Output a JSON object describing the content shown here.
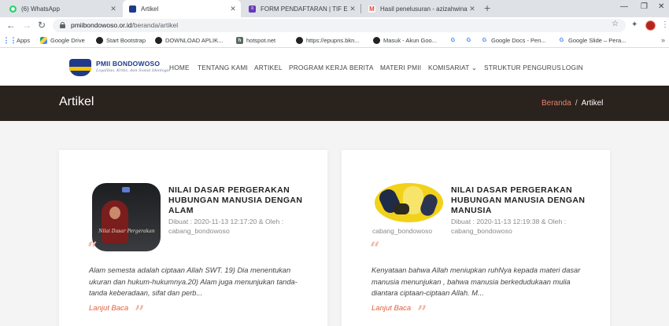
{
  "browser": {
    "tabs": [
      {
        "title": "(6) WhatsApp",
        "icon": "whatsapp-icon",
        "color": "#25d366",
        "glyph": "◉"
      },
      {
        "title": "Artikel",
        "icon": "pmii-logo-icon",
        "color": "#1f3a8a",
        "glyph": ""
      },
      {
        "title": "FORM PENDAFTARAN | TIF EXHIBITION",
        "icon": "google-forms-icon",
        "color": "#673ab7",
        "glyph": "≡"
      },
      {
        "title": "Hasil penelusuran - azizahwinarsih",
        "icon": "gmail-icon",
        "color": "#ea4335",
        "glyph": "M"
      }
    ],
    "new_tab": "+",
    "url_host": "pmiibondowoso.or.id",
    "url_path": "/beranda/artikel",
    "bookmarks": [
      {
        "label": "Apps",
        "icon": "apps-grid-icon"
      },
      {
        "label": "Google Drive",
        "icon": "google-drive-icon"
      },
      {
        "label": "Start Bootstrap",
        "icon": "bootstrap-icon"
      },
      {
        "label": "DOWNLOAD APLIK...",
        "icon": "globe-icon"
      },
      {
        "label": "hotspot.net",
        "icon": "hotspot-icon"
      },
      {
        "label": "https://epupns.bkn...",
        "icon": "globe-icon"
      },
      {
        "label": "Masuk - Akun Goo...",
        "icon": "globe-icon"
      },
      {
        "label": "",
        "icon": "google-icon"
      },
      {
        "label": "",
        "icon": "google-icon"
      },
      {
        "label": "Google Docs - Pen...",
        "icon": "google-icon"
      },
      {
        "label": "Google Slide – Pera...",
        "icon": "google-icon"
      }
    ]
  },
  "site": {
    "brand": "PMII BONDOWOSO",
    "tagline": "Loyalitas, Kritis, dan Sosial Ideologis",
    "menu": [
      "HOME",
      "TENTANG KAMI",
      "ARTIKEL",
      "PROGRAM KERJA",
      "BERITA",
      "MATERI PMII",
      "KOMISARIAT",
      "STRUKTUR PENGURUS",
      "LOGIN"
    ],
    "dropdown_caret": "⌄"
  },
  "banner": {
    "title": "Artikel",
    "breadcrumb_home": "Beranda",
    "breadcrumb_sep": "/",
    "breadcrumb_current": "Artikel"
  },
  "articles": [
    {
      "title": "NILAI DASAR PERGERAKAN HUBUNGAN MANUSIA DENGAN ALAM",
      "meta": "Dibuat : 2020-11-13 12:17:20 & Oleh : cabang_bondowoso",
      "author_under": "",
      "thumb_caption": "Nilai Dasar Pergerakan",
      "excerpt": "Alam semesta adalah ciptaan Allah SWT. 19) Dia menentukan ukuran dan hukum-hukumnya.20) Alam juga menunjukan tanda-tanda keberadaan, sifat dan perb...",
      "read_more": "Lanjut Baca"
    },
    {
      "title": "NILAI DASAR PERGERAKAN HUBUNGAN MANUSIA DENGAN MANUSIA",
      "meta": "Dibuat : 2020-11-13 12:19:38 & Oleh : cabang_bondowoso",
      "author_under": "cabang_bondowoso",
      "thumb_caption": "",
      "excerpt": "Kenyataan bahwa Allah meniupkan ruhNya kepada materi dasar manusia menunjukan , bahwa manusia berkedudukaan mulia diantara ciptaan-ciptaan Allah. M...",
      "read_more": "Lanjut Baca"
    }
  ],
  "quote_open": "“",
  "quote_close": "”",
  "colors": {
    "accent": "#e0603d",
    "banner": "#2a221d",
    "brand": "#1f3a8a"
  }
}
